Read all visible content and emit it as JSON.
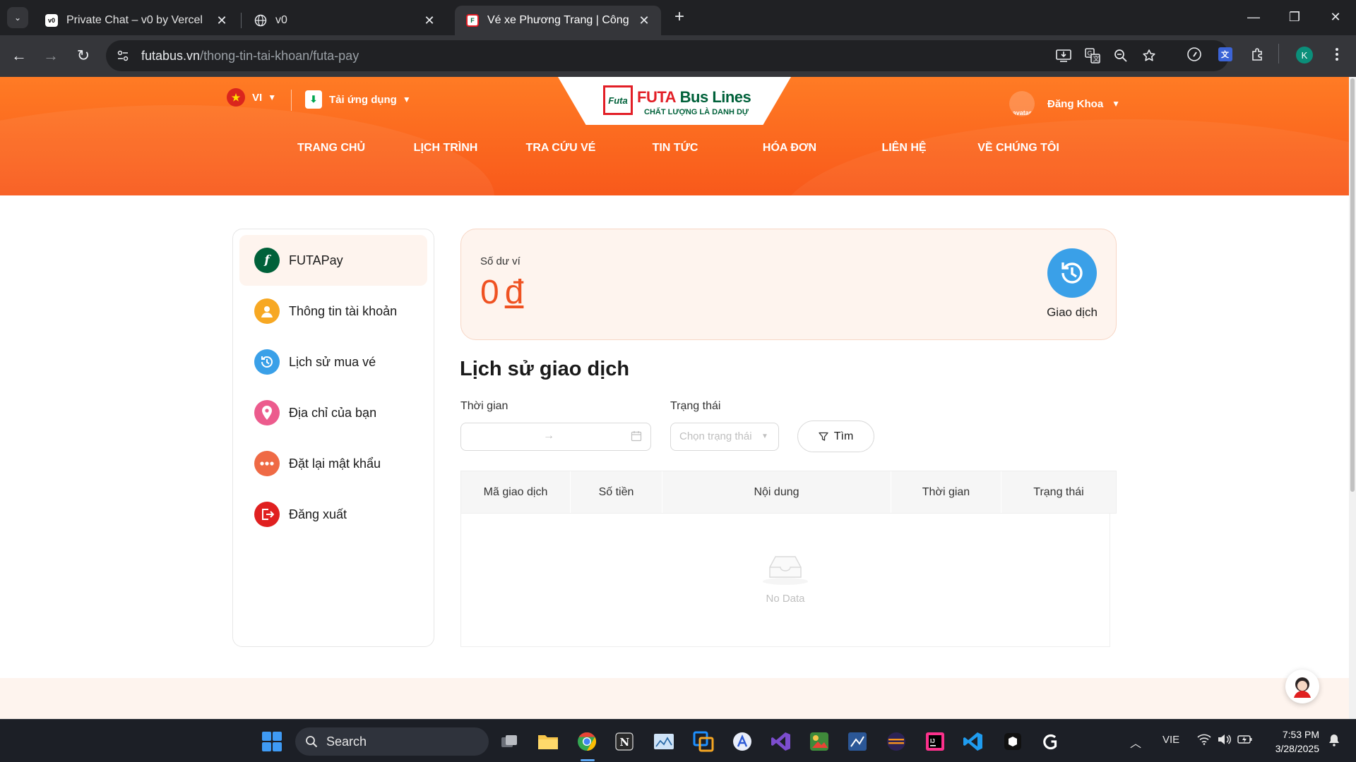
{
  "browser": {
    "tabs": [
      {
        "title": "Private Chat – v0 by Vercel",
        "active": false
      },
      {
        "title": "v0",
        "active": false
      },
      {
        "title": "Vé xe Phương Trang | Công ty c",
        "active": true
      }
    ],
    "url_host": "futabus.vn",
    "url_path": "/thong-tin-tai-khoan/futa-pay",
    "profile_initial": "K"
  },
  "header": {
    "language": "VI",
    "app_download": "Tải ứng dụng",
    "logo_title_part1": "FUTA",
    "logo_title_part2": " Bus Lines",
    "logo_mark": "Futa",
    "logo_slogan": "CHẤT LƯỢNG LÀ DANH DỰ",
    "user_name": "Đăng Khoa",
    "avatar_alt": "avatar",
    "nav": [
      "TRANG CHỦ",
      "LỊCH TRÌNH",
      "TRA CỨU VÉ",
      "TIN TỨC",
      "HÓA ĐƠN",
      "LIÊN HỆ",
      "VỀ CHÚNG TÔI"
    ]
  },
  "sidebar": {
    "items": [
      {
        "label": "FUTAPay",
        "icon": "futapay-icon",
        "active": true,
        "color": "#00613a"
      },
      {
        "label": "Thông tin tài khoản",
        "icon": "user-icon",
        "color": "#f7a823"
      },
      {
        "label": "Lịch sử mua vé",
        "icon": "history-icon",
        "color": "#3aa0e8"
      },
      {
        "label": "Địa chỉ của bạn",
        "icon": "location-pin-icon",
        "color": "#ec5b8d"
      },
      {
        "label": "Đặt lại mật khẩu",
        "icon": "password-icon",
        "color": "#ef6a45"
      },
      {
        "label": "Đăng xuất",
        "icon": "logout-icon",
        "color": "#e02020"
      }
    ]
  },
  "wallet": {
    "label": "Số dư ví",
    "amount": "0",
    "currency": "đ",
    "transaction_label": "Giao dịch"
  },
  "history": {
    "title": "Lịch sử giao dịch",
    "time_label": "Thời gian",
    "status_label": "Trạng thái",
    "status_placeholder": "Chọn trạng thái",
    "find_label": "Tìm",
    "columns": [
      "Mã giao dịch",
      "Số tiền",
      "Nội dung",
      "Thời gian",
      "Trạng thái"
    ],
    "empty_text": "No Data"
  },
  "taskbar": {
    "search_label": "Search",
    "language": "VIE",
    "time": "7:53 PM",
    "date": "3/28/2025"
  },
  "colors": {
    "brand_orange": "#f8591b",
    "brand_green": "#00613a",
    "brand_red": "#e21e26",
    "accent": "#ef5222"
  }
}
